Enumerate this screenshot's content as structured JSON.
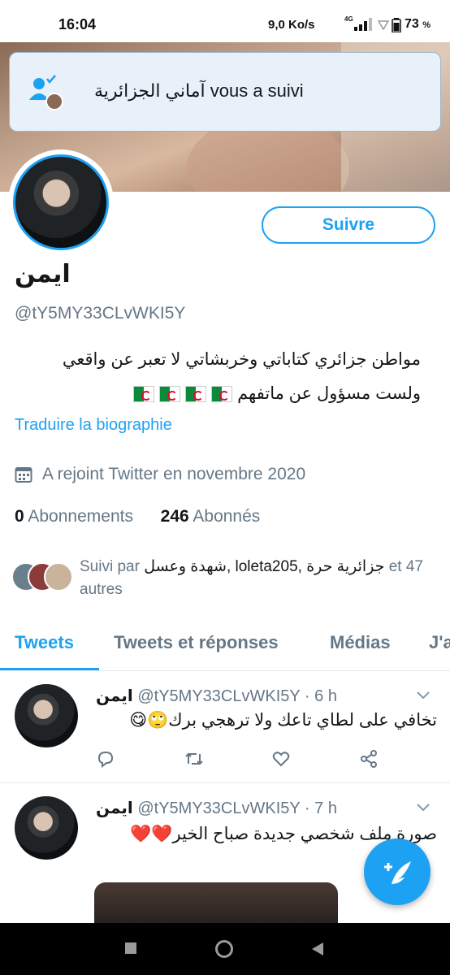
{
  "status_bar": {
    "time": "16:04",
    "network_speed": "9,0 Ko/s",
    "network_type": "4G",
    "battery": "73",
    "battery_unit": "%"
  },
  "notification": {
    "text": "آماني الجزائرية vous a suivi",
    "icon": "follow-notification-icon"
  },
  "profile": {
    "follow_label": "Suivre",
    "name": "ايمن",
    "handle": "@tY5MY33CLvWKI5Y",
    "bio_line1": "مواطن جزائري كتاباتي وخربشاتي لا تعبر عن واقعي",
    "bio_line2": "ولست مسؤول عن ماتفهم",
    "bio_flags": 4,
    "translate_label": "Traduire la biographie",
    "joined": "A rejoint Twitter en novembre 2020",
    "following_count": "0",
    "following_label": "Abonnements",
    "followers_count": "246",
    "followers_label": "Abonnés",
    "followed_by_prefix": "Suivi par",
    "followed_by_names": "شهدة وعسل, loleta205, جزائرية حرة",
    "followed_by_suffix": "et 47 autres"
  },
  "tabs": [
    "Tweets",
    "Tweets et réponses",
    "Médias",
    "J'aime"
  ],
  "tweets": [
    {
      "name": "ايمن",
      "handle": "@tY5MY33CLvWKI5Y",
      "time": "· 6 h",
      "text": "تخافي على لطاي تاعك ولا ترهجي برك🙄😋"
    },
    {
      "name": "ايمن",
      "handle": "@tY5MY33CLvWKI5Y",
      "time": "· 7 h",
      "text": "صورة ملف شخصي جديدة صباح الخير❤️❤️"
    }
  ],
  "colors": {
    "accent": "#1da1f2",
    "secondary_text": "#657786",
    "toast_bg": "#e8f1f9"
  }
}
